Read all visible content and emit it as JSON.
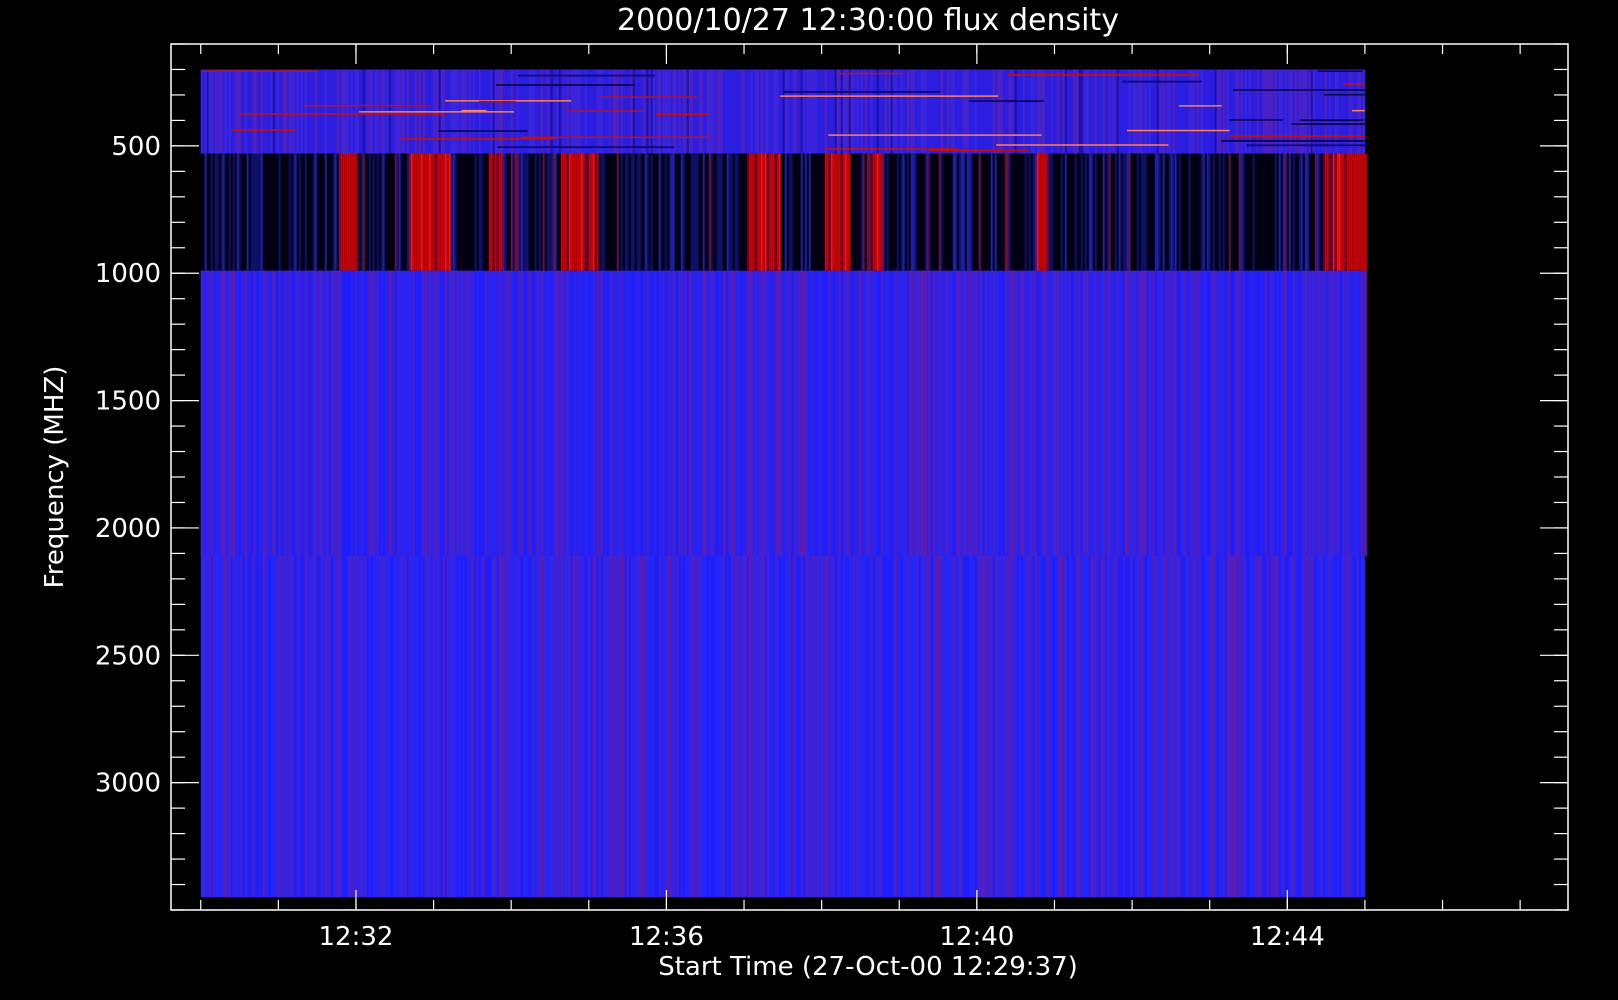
{
  "chart_data": {
    "type": "heatmap",
    "title": "2000/10/27 12:30:00 flux density",
    "xlabel": "Start Time (27-Oct-00 12:29:37)",
    "ylabel": "Frequency (MHZ)",
    "x_range_seconds_from_start": [
      0,
      1080
    ],
    "x_ticks": [
      {
        "label": "12:32",
        "seconds": 143
      },
      {
        "label": "12:36",
        "seconds": 383
      },
      {
        "label": "12:40",
        "seconds": 623
      },
      {
        "label": "12:44",
        "seconds": 863
      }
    ],
    "y_range": [
      3500,
      100
    ],
    "y_inverted": true,
    "y_ticks": [
      500,
      1000,
      1500,
      2000,
      2500,
      3000
    ],
    "data_extent": {
      "time_seconds": [
        23,
        923
      ],
      "frequency": [
        200,
        3450
      ]
    },
    "bands": [
      {
        "name": "band-1",
        "freq": [
          200,
          530
        ],
        "base_color": "#2b1ee0",
        "style": "spectral"
      },
      {
        "name": "band-2",
        "freq": [
          530,
          990
        ],
        "base_color": "#000020",
        "style": "bursty"
      },
      {
        "name": "band-3",
        "freq": [
          990,
          2110
        ],
        "base_color": "#2a22ee",
        "style": "striped"
      },
      {
        "name": "band-4",
        "freq": [
          2110,
          3450
        ],
        "base_color": "#2525f5",
        "style": "striped"
      }
    ],
    "burst_intervals_seconds": [
      [
        130,
        145
      ],
      [
        185,
        215
      ],
      [
        245,
        255
      ],
      [
        300,
        330
      ],
      [
        445,
        470
      ],
      [
        505,
        525
      ],
      [
        540,
        550
      ],
      [
        668,
        676
      ],
      [
        890,
        923
      ]
    ],
    "colormap": [
      "#000000",
      "#1a1aff",
      "#8020c0",
      "#ff0000",
      "#ffffff"
    ]
  }
}
